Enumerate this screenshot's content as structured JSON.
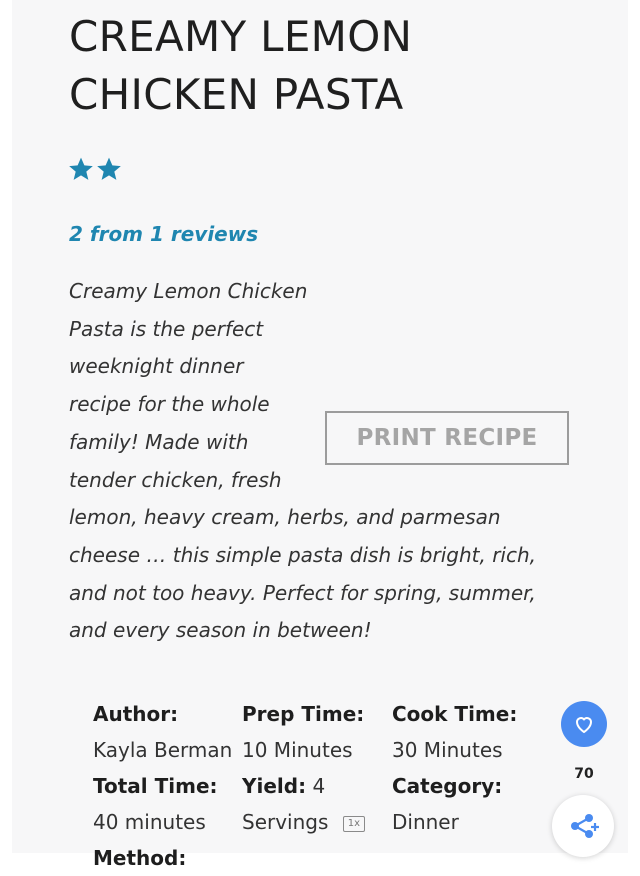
{
  "recipe": {
    "title": "CREAMY LEMON\nCHICKEN PASTA",
    "rating": 2,
    "rating_max": 5,
    "reviews_text": "2 from 1 reviews",
    "summary_lines": [
      "Creamy Lemon Chicken",
      "Pasta is the perfect",
      "weeknight dinner",
      "recipe for the whole",
      "family! Made with",
      "tender chicken, fresh",
      "lemon, heavy cream, herbs, and parmesan",
      "cheese … this simple pasta dish is bright, rich,",
      "and not too heavy. Perfect for spring, summer,",
      "and every season in between!"
    ],
    "print_label": "PRINT RECIPE"
  },
  "meta": {
    "author_label": "Author:",
    "author_value": "Kayla Berman",
    "prep_label": "Prep Time:",
    "prep_value": "10 Minutes",
    "cook_label": "Cook Time:",
    "cook_value": "30 Minutes",
    "total_label": "Total Time:",
    "total_value": "40 minutes",
    "yield_label": "Yield:",
    "yield_value": "4 Servings",
    "scale_label": "1x",
    "category_label": "Category:",
    "category_value": "Dinner",
    "method_label": "Method:"
  },
  "floating": {
    "favorite_count": "70",
    "favorite_icon": "heart-icon",
    "share_icon": "share-plus-icon"
  },
  "colors": {
    "accent": "#1f86b0",
    "star": "#1f86b0",
    "fab": "#4a8bf0"
  }
}
